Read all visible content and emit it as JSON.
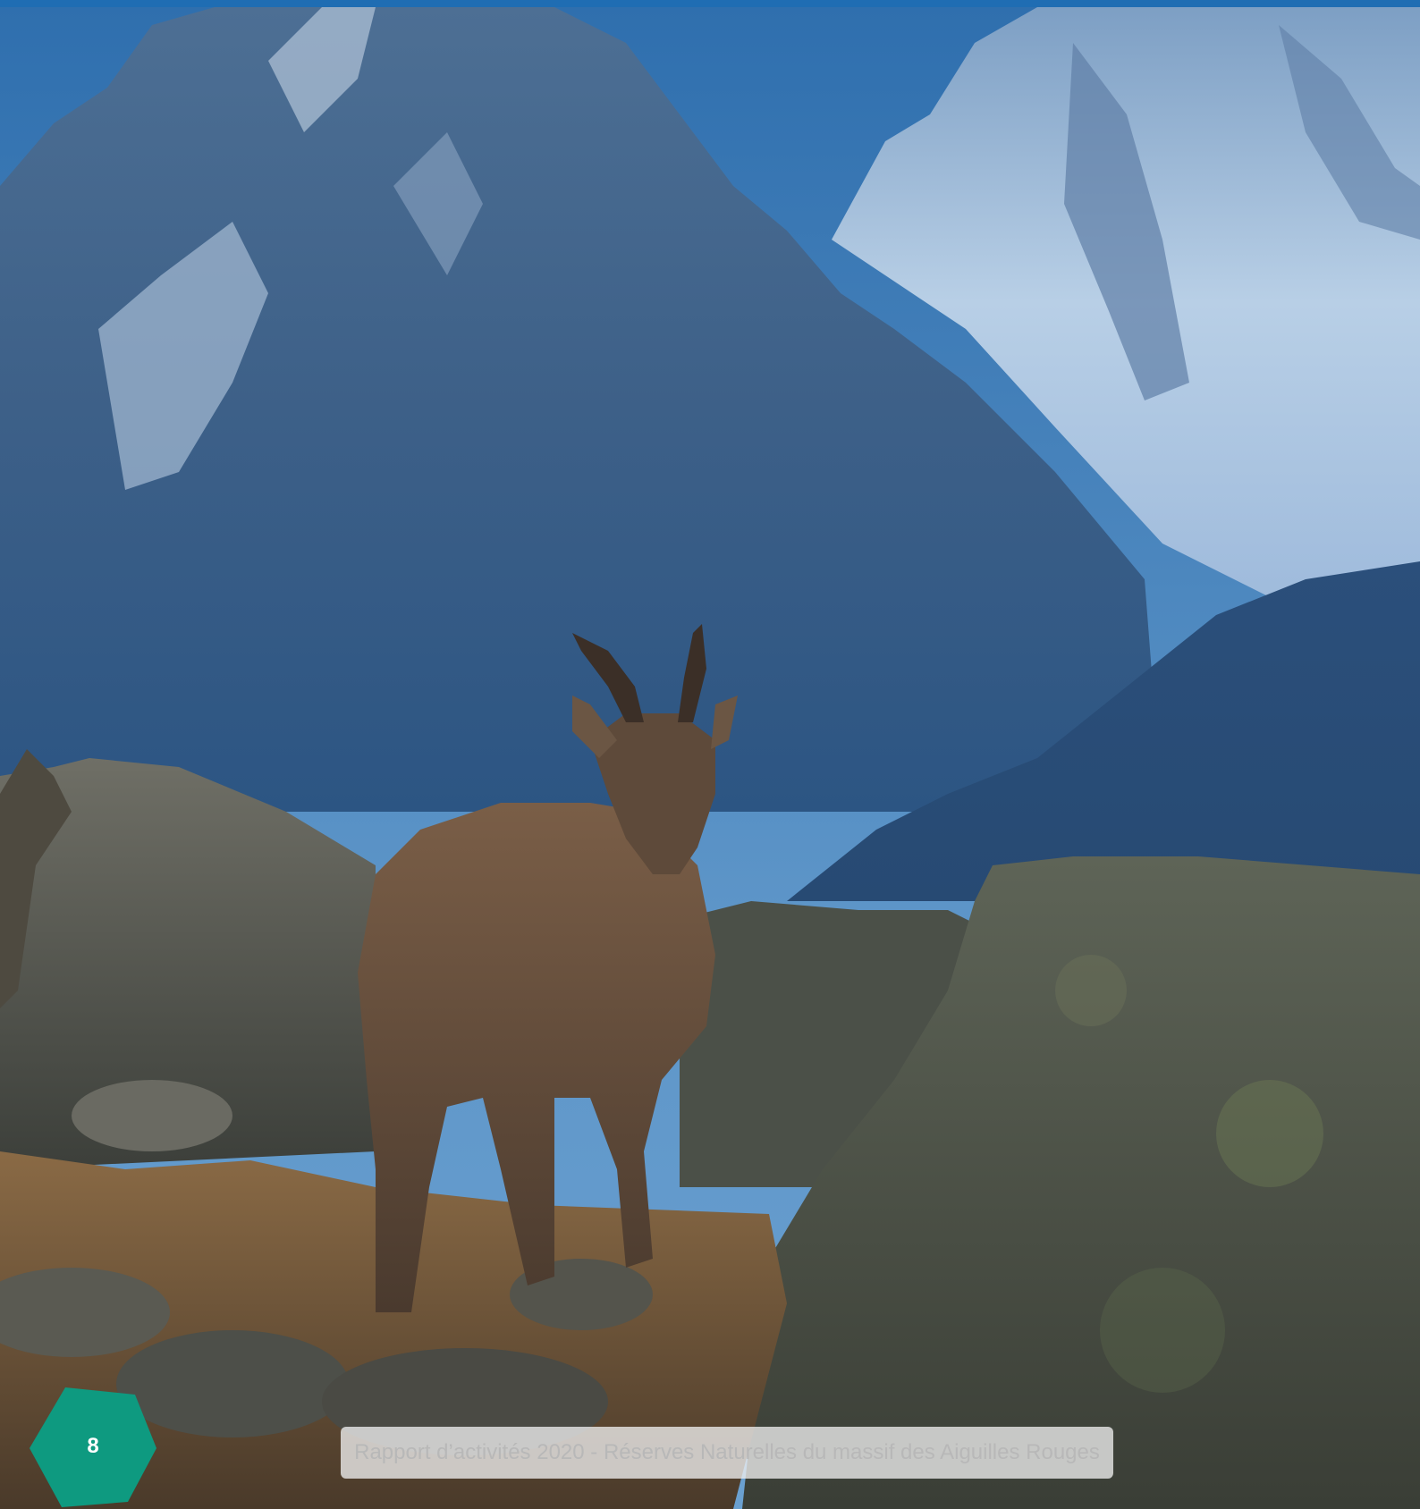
{
  "colors": {
    "top_bar": "#1f6db3",
    "badge": "#0e9a80",
    "footer_text": "#b8b8b8"
  },
  "photo": {
    "subject": "ibex-photo"
  },
  "page_number": "8",
  "footer": {
    "text": "Rapport d’activités 2020 - Réserves Naturelles du massif des Aiguilles Rouges"
  }
}
